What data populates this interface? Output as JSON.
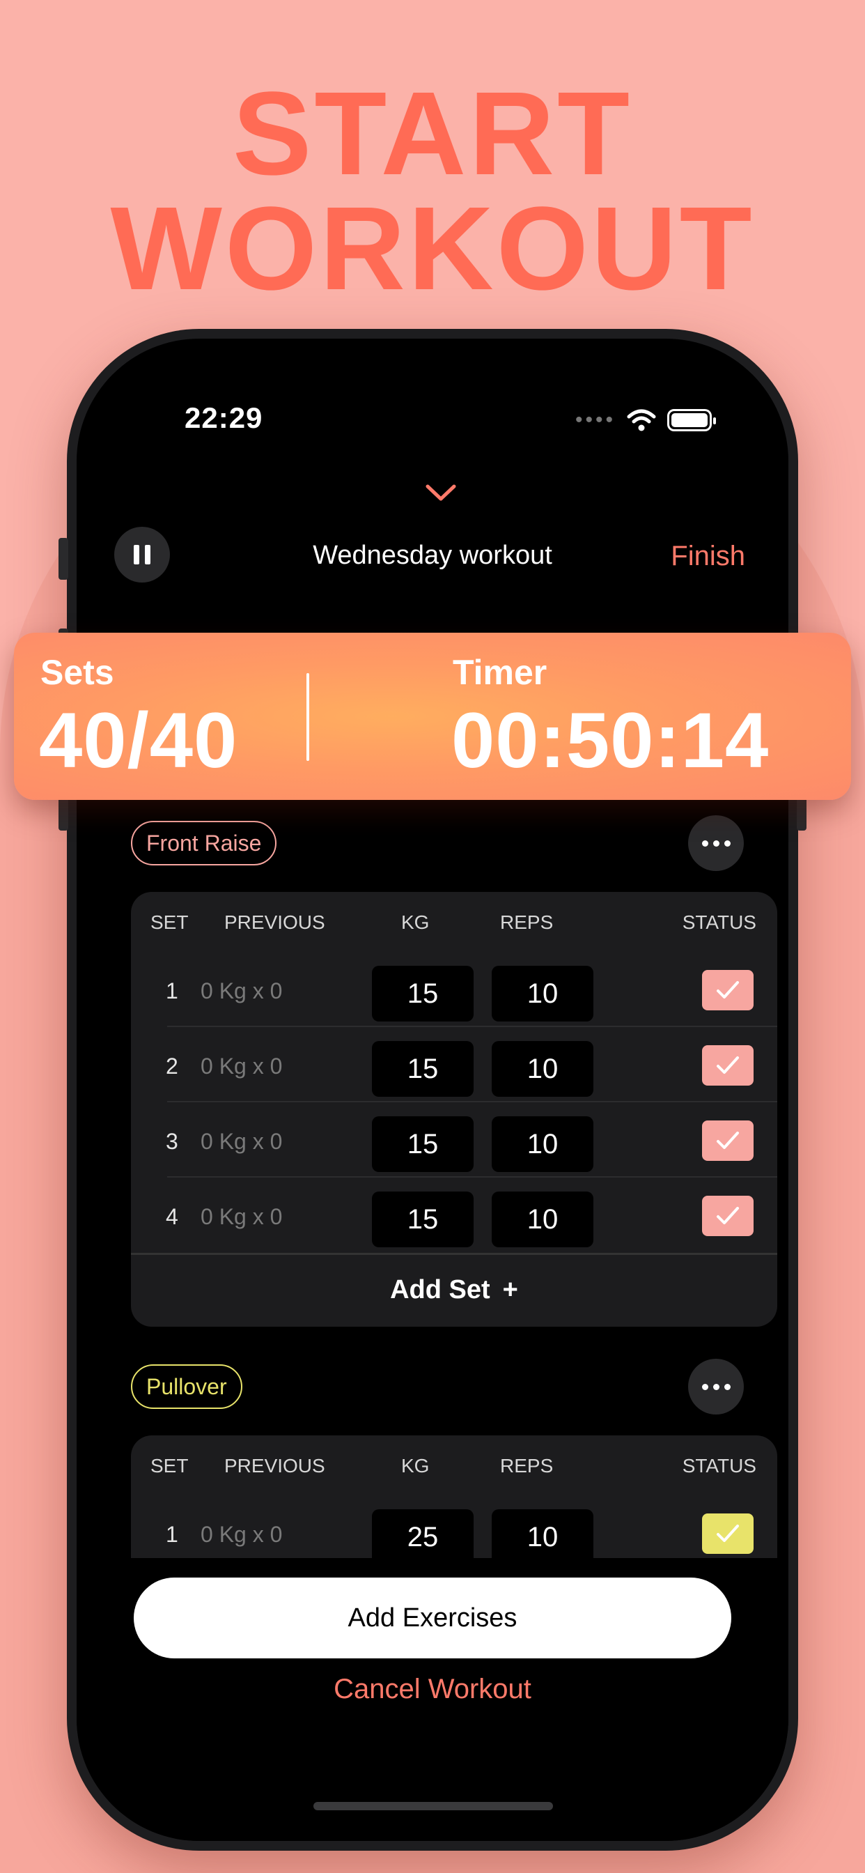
{
  "headline": {
    "line1": "START",
    "line2": "WORKOUT"
  },
  "status_bar": {
    "time": "22:29"
  },
  "nav": {
    "title": "Wednesday workout",
    "finish": "Finish"
  },
  "stats": {
    "sets_label": "Sets",
    "sets_value": "40/40",
    "timer_label": "Timer",
    "timer_value": "00:50:14"
  },
  "table_headers": {
    "set": "SET",
    "previous": "PREVIOUS",
    "kg": "KG",
    "reps": "REPS",
    "status": "STATUS"
  },
  "exercises": [
    {
      "name": "Front Raise",
      "color": "#f7a6a0",
      "sets": [
        {
          "num": "1",
          "previous": "0 Kg x 0",
          "kg": "15",
          "reps": "10"
        },
        {
          "num": "2",
          "previous": "0 Kg x 0",
          "kg": "15",
          "reps": "10"
        },
        {
          "num": "3",
          "previous": "0 Kg x 0",
          "kg": "15",
          "reps": "10"
        },
        {
          "num": "4",
          "previous": "0 Kg x 0",
          "kg": "15",
          "reps": "10"
        }
      ],
      "add_set": "Add Set",
      "add_set_icon": "+"
    },
    {
      "name": "Pullover",
      "color": "#e8e36a",
      "sets": [
        {
          "num": "1",
          "previous": "0 Kg x 0",
          "kg": "25",
          "reps": "10"
        }
      ]
    }
  ],
  "actions": {
    "add_exercises": "Add Exercises",
    "cancel_workout": "Cancel Workout"
  },
  "icons": {
    "collapse": "chevron-down-icon",
    "pause": "pause-icon",
    "more": "more-icon",
    "check": "checkmark-icon",
    "wifi": "wifi-icon",
    "battery": "battery-icon"
  }
}
